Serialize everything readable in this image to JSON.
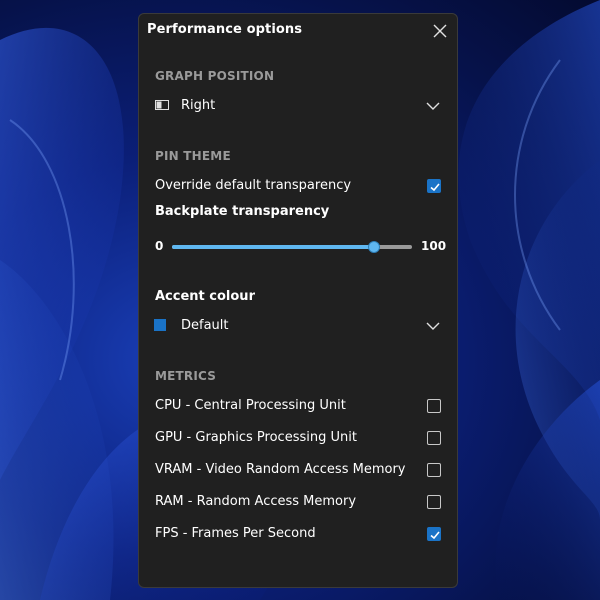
{
  "window": {
    "title": "Performance options",
    "close_icon": "close-icon"
  },
  "graph_position": {
    "heading": "GRAPH POSITION",
    "value": "Right",
    "icon": "panel-right-icon"
  },
  "pin_theme": {
    "heading": "PIN THEME",
    "override_label": "Override default transparency",
    "override_checked": true,
    "backplate_label": "Backplate transparency",
    "slider_min": "0",
    "slider_max": "100",
    "slider_value": 84
  },
  "accent": {
    "label": "Accent colour",
    "value": "Default",
    "swatch_color": "#1a73c7"
  },
  "metrics": {
    "heading": "METRICS",
    "items": [
      {
        "label": "CPU - Central Processing Unit",
        "checked": false
      },
      {
        "label": "GPU - Graphics Processing Unit",
        "checked": false
      },
      {
        "label": "VRAM - Video Random Access Memory",
        "checked": false
      },
      {
        "label": "RAM - Random Access Memory",
        "checked": false
      },
      {
        "label": "FPS - Frames Per Second",
        "checked": true
      }
    ]
  },
  "colors": {
    "panel_bg": "#202020",
    "accent": "#1a73c7",
    "slider_fill": "#5fb7f0",
    "heading_gray": "#9a9a9a"
  }
}
